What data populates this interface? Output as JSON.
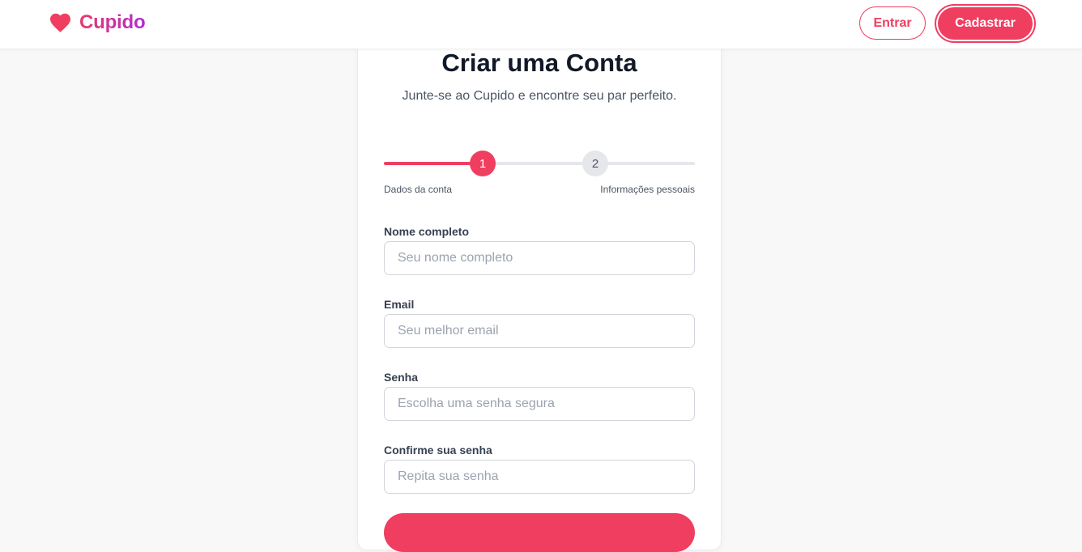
{
  "header": {
    "brand": "Cupido",
    "brand_icon": "heart-icon",
    "login_label": "Entrar",
    "signup_label": "Cadastrar"
  },
  "form": {
    "title": "Criar uma Conta",
    "subtitle": "Junte-se ao Cupido e encontre seu par perfeito.",
    "steps": [
      {
        "number": "1",
        "label": "Dados da conta",
        "active": true
      },
      {
        "number": "2",
        "label": "Informações pessoais",
        "active": false
      }
    ],
    "fields": [
      {
        "label": "Nome completo",
        "placeholder": "Seu nome completo",
        "value": ""
      },
      {
        "label": "Email",
        "placeholder": "Seu melhor email",
        "value": ""
      },
      {
        "label": "Senha",
        "placeholder": "Escolha uma senha segura",
        "value": ""
      },
      {
        "label": "Confirme sua senha",
        "placeholder": "Repita sua senha",
        "value": ""
      }
    ]
  },
  "colors": {
    "accent": "#ef3e60",
    "brand_gradient_start": "#e83a6b",
    "brand_gradient_end": "#b22ccf",
    "background": "#f8f8f9"
  }
}
